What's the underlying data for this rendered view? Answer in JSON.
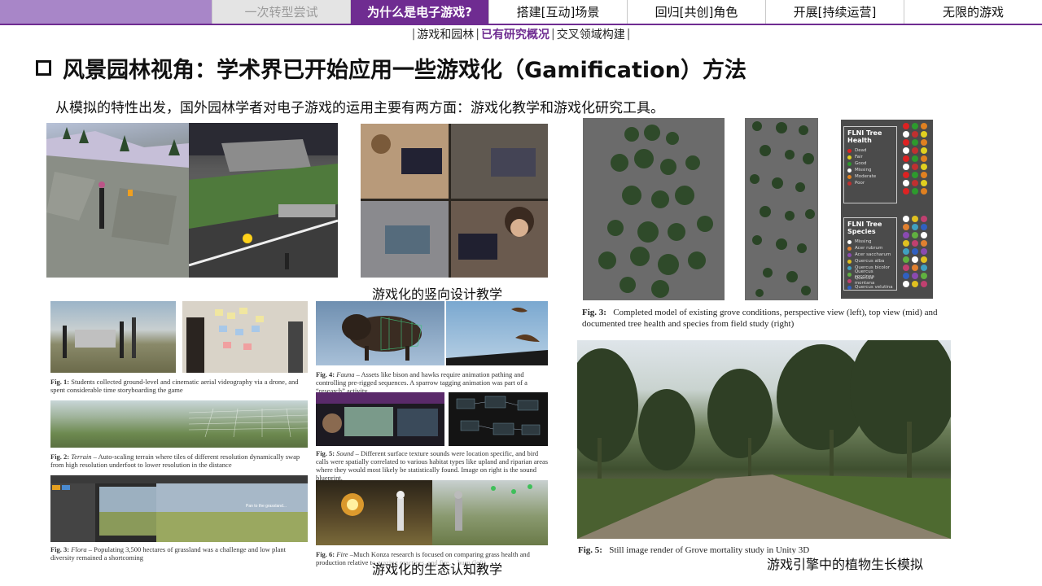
{
  "nav": {
    "tabs": [
      {
        "label": "一次转型尝试",
        "state": "dim"
      },
      {
        "label": "为什么是电子游戏?",
        "state": "active"
      },
      {
        "label": "搭建[互动]场景",
        "state": "normal"
      },
      {
        "label": "回归[共创]角色",
        "state": "normal"
      },
      {
        "label": "开展[持续运营]",
        "state": "normal"
      },
      {
        "label": "无限的游戏",
        "state": "normal"
      }
    ],
    "accent": "#6f2c91"
  },
  "subnav": {
    "items": [
      "游戏和园林",
      "已有研究概况",
      "交叉领域构建"
    ],
    "current_index": 1
  },
  "heading": {
    "title": "风景园林视角：学术界已开始应用一些游戏化（Gamification）方法",
    "intro": "从模拟的特性出发，国外园林学者对电子游戏的运用主要有两方面：游戏化教学和游戏化研究工具。"
  },
  "captions": {
    "vertical_design": "游戏化的竖向设计教学",
    "ecology": "游戏化的生态认知教学",
    "engine": "游戏引擎中的植物生长模拟"
  },
  "figures": {
    "fig1": {
      "label": "Fig. 1:",
      "text": "Students collected ground-level and cinematic aerial videography via a drone, and spent considerable time storyboarding the game"
    },
    "fig2": {
      "label": "Fig. 2:",
      "italic": "Terrain",
      "text": "– Auto-scaling terrain where tiles of different resolution dynamically swap from high resolution underfoot to lower resolution in the distance"
    },
    "fig3": {
      "label": "Fig. 3:",
      "italic": "Flora",
      "text": "– Populating 3,500 hectares of grassland was a challenge and low plant diversity remained a shortcoming"
    },
    "fig4": {
      "label": "Fig. 4:",
      "italic": "Fauna",
      "text": "– Assets like bison and hawks require animation pathing and controlling pre-rigged sequences. A sparrow tagging animation was part of a “research” activity"
    },
    "fig5": {
      "label": "Fig. 5:",
      "italic": "Sound",
      "text": "– Different surface texture sounds were location specific, and bird calls were spatially correlated to various habitat types like upland and riparian areas where they would most likely be statistically found. Image on right is the sound blueprint."
    },
    "fig6": {
      "label": "Fig. 6:",
      "italic": "Fire",
      "text": "–Much Konza research is focused on comparing grass health and production relative to grazing practices, and fire… burn (left)"
    },
    "grove": {
      "label": "Fig. 3:",
      "text": "Completed model of existing grove conditions, perspective view (left), top view (mid) and documented tree health and species from field study (right)"
    },
    "render": {
      "label": "Fig. 5:",
      "text": "Still image render of Grove mortality study in Unity 3D"
    }
  },
  "legend_health": {
    "title": "FLNI Tree Health",
    "items": [
      {
        "label": "Dead",
        "color": "#d22"
      },
      {
        "label": "Fair",
        "color": "#e0d020"
      },
      {
        "label": "Good",
        "color": "#2d9a2d"
      },
      {
        "label": "Missing",
        "color": "#ffffff"
      },
      {
        "label": "Moderate",
        "color": "#e08020"
      },
      {
        "label": "Poor",
        "color": "#c03030"
      }
    ]
  },
  "legend_species": {
    "title": "FLNI Tree Species",
    "items": [
      {
        "label": "Missing",
        "color": "#ffffff"
      },
      {
        "label": "Acer rubrum",
        "color": "#e08030"
      },
      {
        "label": "Acer saccharum",
        "color": "#8a4ab0"
      },
      {
        "label": "Quercus alba",
        "color": "#e0c020"
      },
      {
        "label": "Quercus bicolor",
        "color": "#40a0c0"
      },
      {
        "label": "Quercus coccinea",
        "color": "#60b040"
      },
      {
        "label": "Quercus montana",
        "color": "#c04070"
      },
      {
        "label": "Quercus velutina",
        "color": "#3060c0"
      }
    ]
  },
  "video_label": "Pan to the grassland..."
}
